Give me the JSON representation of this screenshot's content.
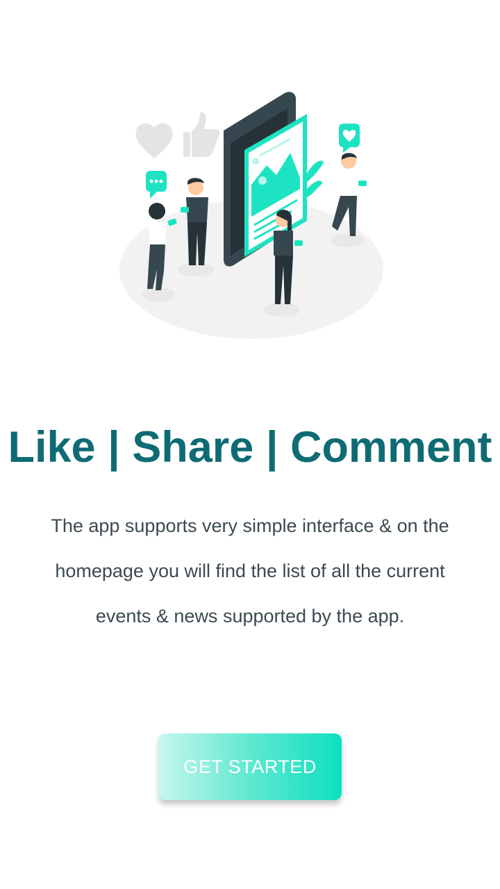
{
  "onboarding": {
    "illustration_name": "social-media-people-illustration",
    "headline": "Like | Share | Comment",
    "description": "The app supports very simple interface & on the homepage you will find the list of all the current events & news supported by the app.",
    "cta_label": "GET STARTED"
  },
  "colors": {
    "headline": "#0f6b73",
    "body_text": "#3b4a50",
    "accent": "#1de3c2",
    "dark_figure": "#37474f",
    "ground": "#f2f2f2"
  },
  "icons": [
    "heart-icon",
    "thumbs-up-icon",
    "chat-bubble-icon",
    "heart-bubble-icon"
  ]
}
